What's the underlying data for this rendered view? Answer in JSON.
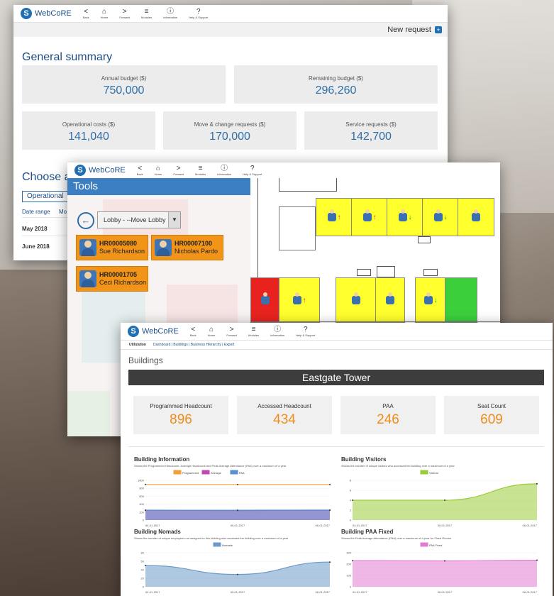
{
  "brand": {
    "name": "WebCoRE"
  },
  "nav": [
    {
      "icon": "back-icon",
      "glyph": "<",
      "label": "Back"
    },
    {
      "icon": "home-icon",
      "glyph": "⌂",
      "label": "Home"
    },
    {
      "icon": "forward-icon",
      "glyph": ">",
      "label": "Forward"
    },
    {
      "icon": "modules-icon",
      "glyph": "≡",
      "label": "Modules"
    },
    {
      "icon": "information-icon",
      "glyph": "ⓘ",
      "label": "Information"
    },
    {
      "icon": "help-icon",
      "glyph": "?",
      "label": "Help & Support"
    }
  ],
  "summary": {
    "new_request": "New request",
    "title": "General summary",
    "cards": [
      {
        "label": "Annual budget ($)",
        "value": "750,000"
      },
      {
        "label": "Remaining budget ($)",
        "value": "296,260"
      },
      {
        "label": "Operational costs ($)",
        "value": "141,040"
      },
      {
        "label": "Move & change requests ($)",
        "value": "170,000"
      },
      {
        "label": "Service requests ($)",
        "value": "142,700"
      }
    ],
    "choose_title": "Choose a",
    "tab_label": "Operational",
    "date_range_label": "Date range",
    "date_range_extra": "Mo",
    "rows": [
      "May 2018",
      "June 2018"
    ]
  },
  "tools": {
    "title": "Tools",
    "dropdown": "Lobby - --Move Lobby",
    "employees": [
      {
        "id": "HR00005080",
        "name": "Sue Richardson"
      },
      {
        "id": "HR00007100",
        "name": "Nicholas Pardo"
      },
      {
        "id": "HR00001705",
        "name": "Ceci Richardson"
      }
    ]
  },
  "buildings": {
    "breadcrumb_section": "Utilization",
    "breadcrumb_path": "Dashboard | Buildings | Business Hierarchy | Export",
    "title": "Buildings",
    "building_name": "Eastgate Tower",
    "kpis": [
      {
        "label": "Programmed Headcount",
        "value": "896"
      },
      {
        "label": "Accessed Headcount",
        "value": "434"
      },
      {
        "label": "PAA",
        "value": "246"
      },
      {
        "label": "Seat Count",
        "value": "609"
      }
    ],
    "accent": "#f08c1a"
  },
  "chart_data": [
    {
      "type": "area",
      "title": "Building Information",
      "subtitle": "Shows the Programmed Headcount, Average Headcount and Peak Average Attendance (PAA) over a maximum of a year",
      "x": [
        "04-01-2017",
        "05-01-2017",
        "06-01-2017"
      ],
      "ylim": [
        0,
        1000
      ],
      "yticks": [
        0,
        200,
        400,
        600,
        800,
        1000
      ],
      "series": [
        {
          "name": "Programmed",
          "color": "#f0a23a",
          "values": [
            896,
            896,
            896
          ]
        },
        {
          "name": "Average",
          "color": "#c04bb0",
          "values": [
            246,
            240,
            246
          ]
        },
        {
          "name": "PAA",
          "color": "#5a8fd0",
          "values": [
            250,
            248,
            252
          ]
        }
      ]
    },
    {
      "type": "area",
      "title": "Building Visitors",
      "subtitle": "Shows the number of unique visitors who accessed the building over a maximum of a year",
      "x": [
        "04-01-2017",
        "05-01-2017",
        "06-01-2017"
      ],
      "ylim": [
        0,
        8
      ],
      "yticks": [
        0,
        2,
        4,
        6,
        8
      ],
      "series": [
        {
          "name": "Visitors",
          "color": "#9acd3a",
          "values": [
            4,
            4,
            7.3
          ]
        }
      ]
    },
    {
      "type": "area",
      "title": "Building Nomads",
      "subtitle": "Shows the number of unique employees not assigned to this building who accessed the building over a maximum of a year",
      "x": [
        "04-01-2017",
        "05-01-2017",
        "06-01-2017"
      ],
      "ylim": [
        0,
        80
      ],
      "yticks": [
        0,
        20,
        40,
        60,
        80
      ],
      "series": [
        {
          "name": "Nomads",
          "color": "#6d9bc9",
          "values": [
            50,
            29,
            58
          ]
        }
      ]
    },
    {
      "type": "area",
      "title": "Building PAA Fixed",
      "subtitle": "Shows the Peak Average Attendance (PAA) over a maximum of a year for Fixed Rooms",
      "x": [
        "04-01-2017",
        "05-01-2017",
        "06-01-2017"
      ],
      "ylim": [
        0,
        300
      ],
      "yticks": [
        0,
        100,
        200,
        300
      ],
      "series": [
        {
          "name": "PAA Fixed",
          "color": "#e07cd0",
          "values": [
            230,
            228,
            234
          ]
        }
      ]
    }
  ]
}
